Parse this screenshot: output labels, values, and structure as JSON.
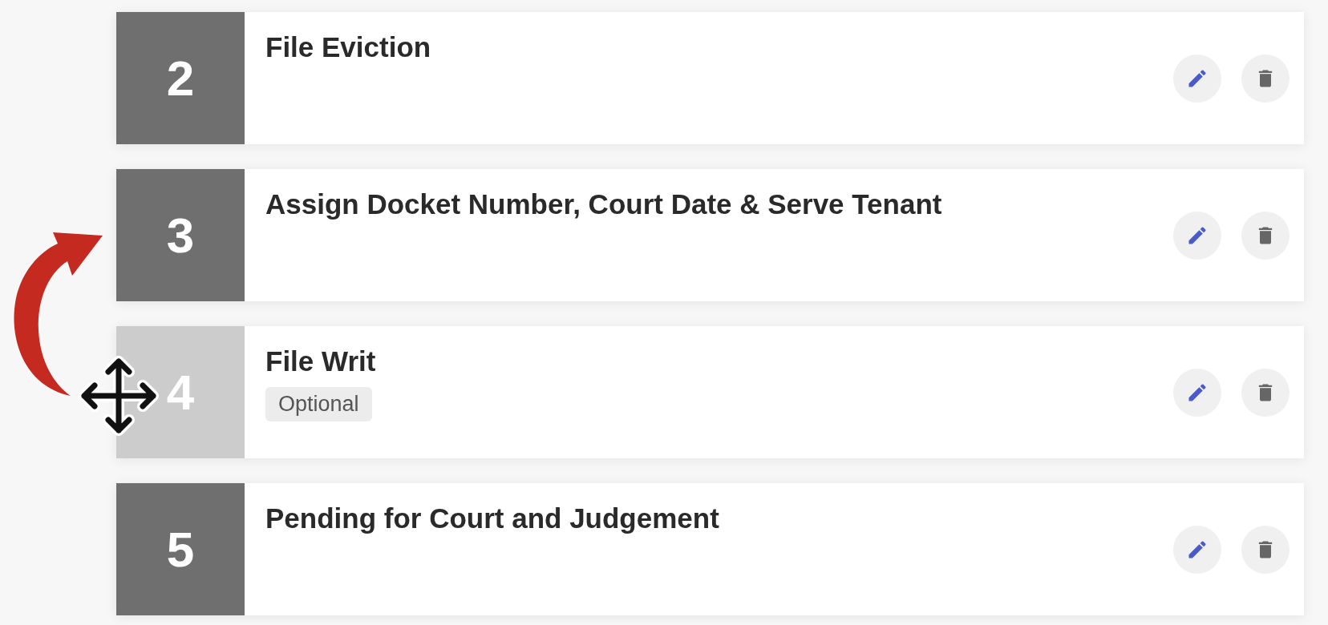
{
  "steps": [
    {
      "number": "2",
      "title": "File Eviction",
      "dragging": false
    },
    {
      "number": "3",
      "title": "Assign Docket Number, Court Date & Serve Tenant",
      "dragging": false
    },
    {
      "number": "4",
      "title": "File Writ",
      "tag": "Optional",
      "dragging": true
    },
    {
      "number": "5",
      "title": "Pending for Court and Judgement",
      "dragging": false
    }
  ]
}
